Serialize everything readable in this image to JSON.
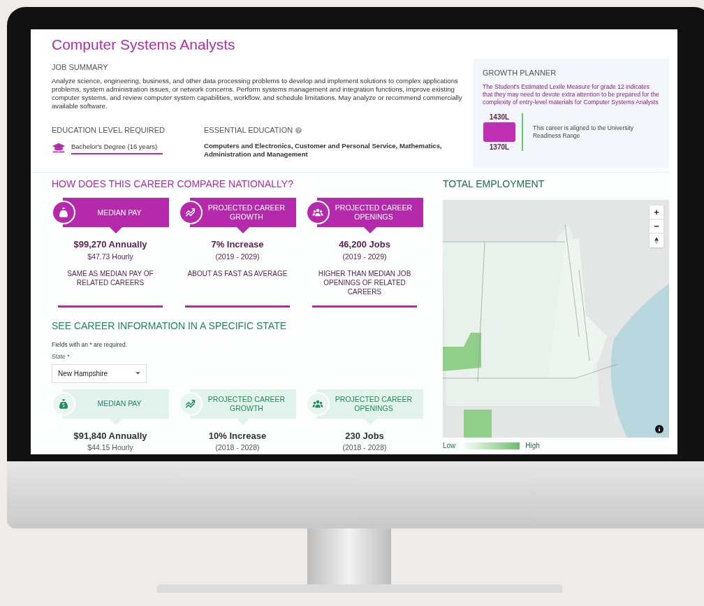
{
  "career": {
    "title": "Computer Systems Analysts",
    "job_summary": {
      "heading": "JOB SUMMARY",
      "text": "Analyze science, engineering, business, and other data processing problems to develop and implement solutions to complex applications problems, system administration issues, or network concerns. Perform systems management and integration functions, improve existing computer systems, and review computer system capabilities, workflow, and schedule limitations. May analyze or recommend commercially available software."
    },
    "education_level": {
      "heading": "EDUCATION LEVEL REQUIRED",
      "value": "Bachelor's Degree (16 years)"
    },
    "essential_education": {
      "heading": "ESSENTIAL EDUCATION",
      "value": "Computers and Electronics, Customer and Personal Service, Mathematics, Administration and Management"
    }
  },
  "growth_planner": {
    "heading": "GROWTH PLANNER",
    "text": "The Student's Estimated Lexile Measure for grade 12 indicates that they may need to devote extra attention to be prepared for the complexity of entry-level materials for Computer Systems Analysts",
    "range_high": "1430L",
    "range_low": "1370L",
    "note": "This career is aligned to the University Readiness Range"
  },
  "national": {
    "heading": "HOW DOES THIS CAREER COMPARE NATIONALLY?",
    "cards": [
      {
        "kind": "pay",
        "label": "MEDIAN PAY",
        "value": "$99,270 Annually",
        "sub": "$47.73 Hourly",
        "comparison": "SAME AS MEDIAN PAY OF RELATED CAREERS"
      },
      {
        "kind": "growth",
        "label": "PROJECTED CAREER GROWTH",
        "value": "7% Increase",
        "sub": "(2019 - 2029)",
        "comparison": "ABOUT AS FAST AS AVERAGE"
      },
      {
        "kind": "openings",
        "label": "PROJECTED CAREER OPENINGS",
        "value": "46,200 Jobs",
        "sub": "(2019 - 2029)",
        "comparison": "HIGHER THAN MEDIAN JOB OPENINGS OF RELATED CAREERS"
      }
    ]
  },
  "state_info": {
    "heading": "SEE CAREER INFORMATION IN A SPECIFIC STATE",
    "required_note": "Fields with an * are required.",
    "state_field": {
      "label": "State *",
      "value": "New Hampshire"
    },
    "cards": [
      {
        "kind": "pay",
        "label": "MEDIAN PAY",
        "value": "$91,840 Annually",
        "sub": "$44.15 Hourly"
      },
      {
        "kind": "growth",
        "label": "PROJECTED CAREER GROWTH",
        "value": "10% Increase",
        "sub": "(2018 - 2028)"
      },
      {
        "kind": "openings",
        "label": "PROJECTED CAREER OPENINGS",
        "value": "230 Jobs",
        "sub": "(2018 - 2028)"
      }
    ]
  },
  "total_employment": {
    "heading": "TOTAL EMPLOYMENT",
    "zoom_in": "+",
    "zoom_out": "−",
    "legend": {
      "low": "Low",
      "high": "High"
    }
  }
}
